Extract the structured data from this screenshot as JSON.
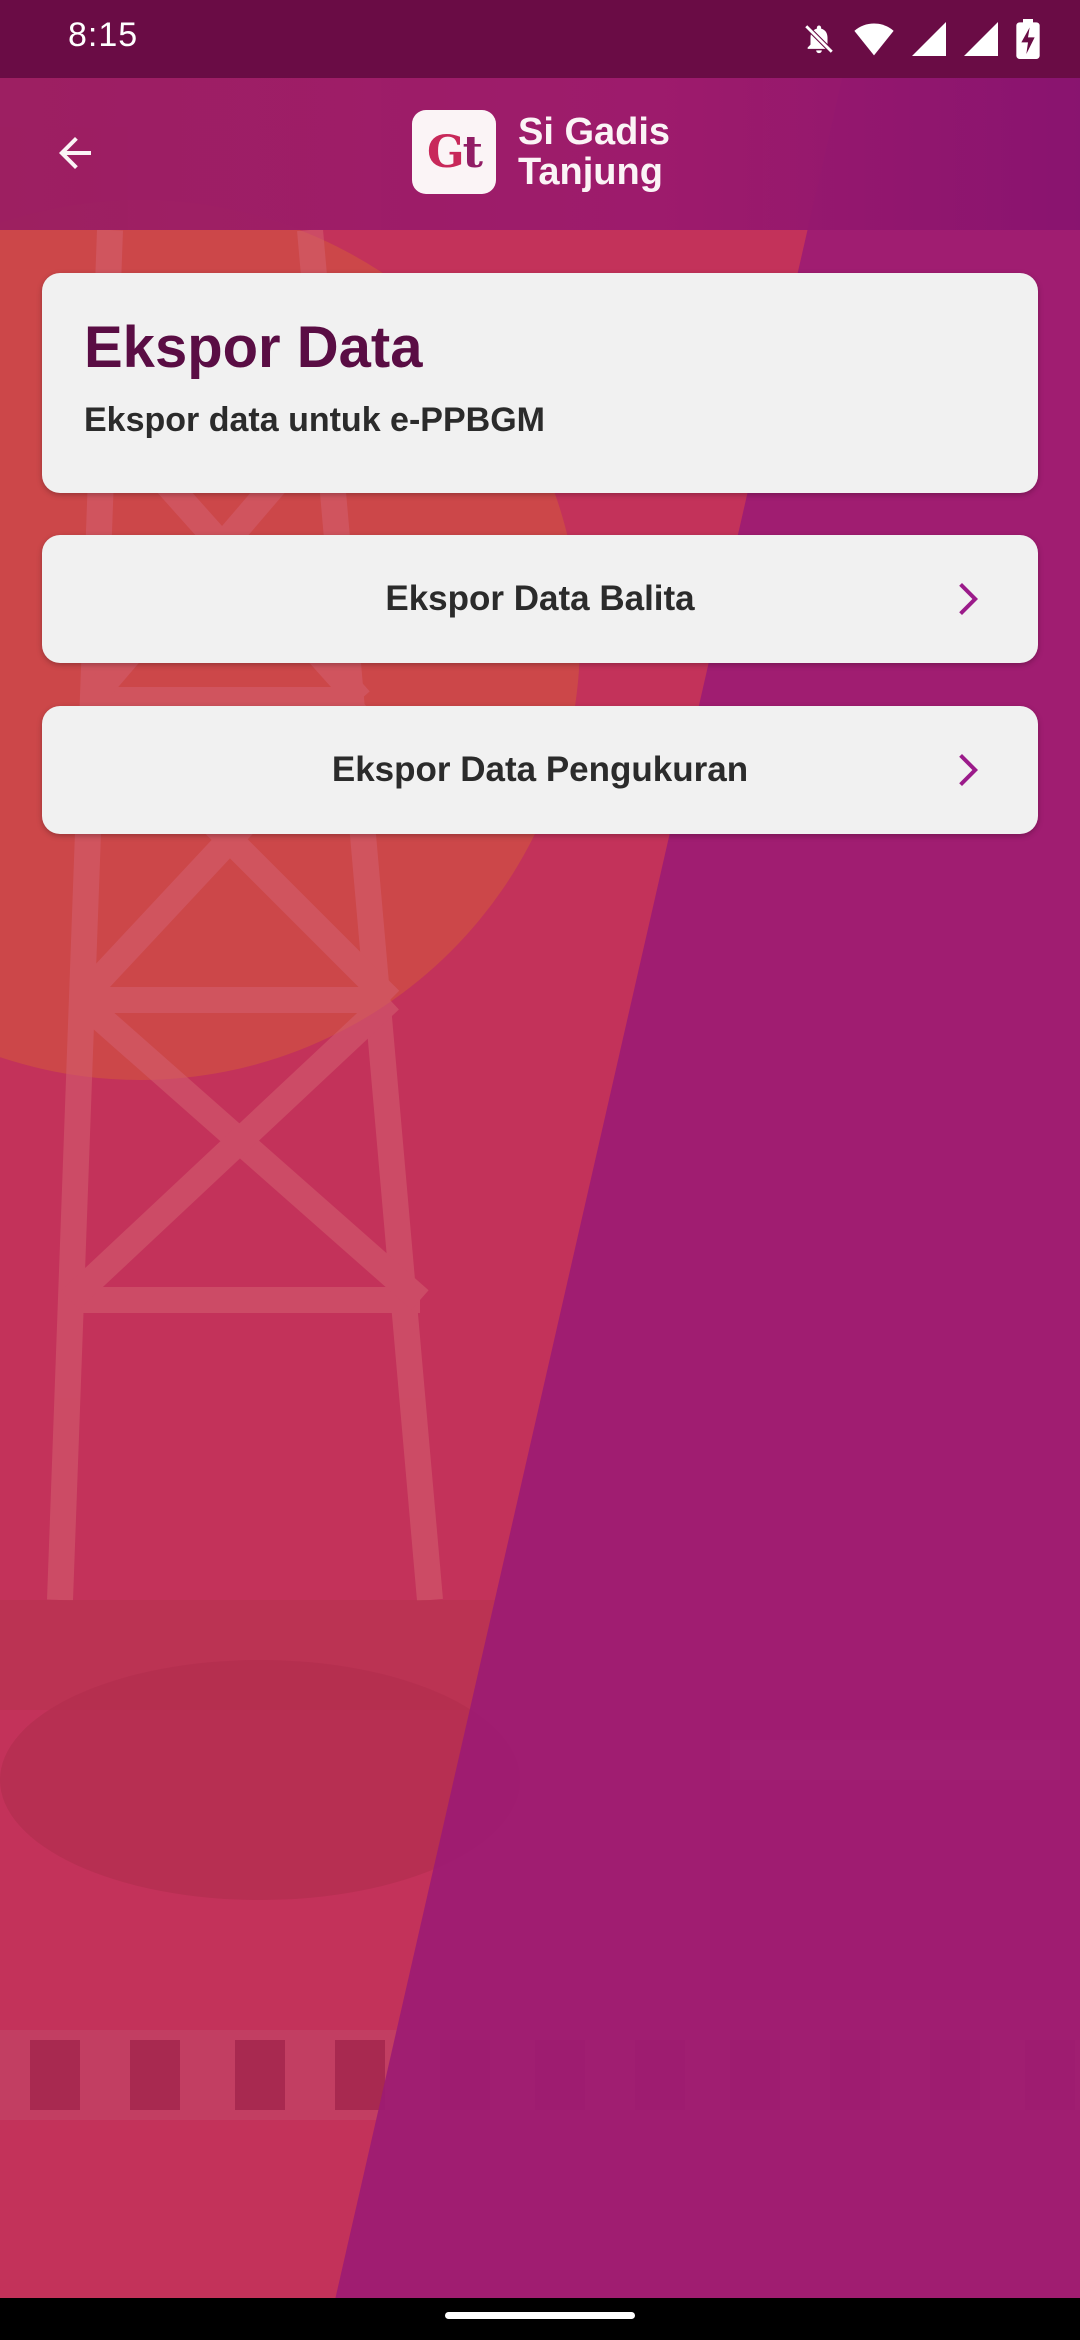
{
  "status_bar": {
    "time": "8:15",
    "icons": [
      "bell-off-icon",
      "wifi-icon",
      "signal-icon",
      "signal-icon",
      "battery-charging-icon"
    ]
  },
  "app_bar": {
    "back_icon": "arrow-left-icon",
    "logo_mark_g": "G",
    "logo_mark_t": "t",
    "logo_line1": "Si Gadis",
    "logo_line2": "Tanjung"
  },
  "header_card": {
    "title": "Ekspor Data",
    "subtitle": "Ekspor data untuk e-PPBGM"
  },
  "menu": [
    {
      "label": "Ekspor Data Balita",
      "icon": "chevron-right-icon"
    },
    {
      "label": "Ekspor Data Pengukuran",
      "icon": "chevron-right-icon"
    }
  ],
  "colors": {
    "status_bar_bg": "#6a0c45",
    "app_bar_bg": "#9b1e62",
    "title_color": "#5a0d44",
    "accent_chevron": "#9b1b8a",
    "card_bg": "#f1f1f1"
  }
}
